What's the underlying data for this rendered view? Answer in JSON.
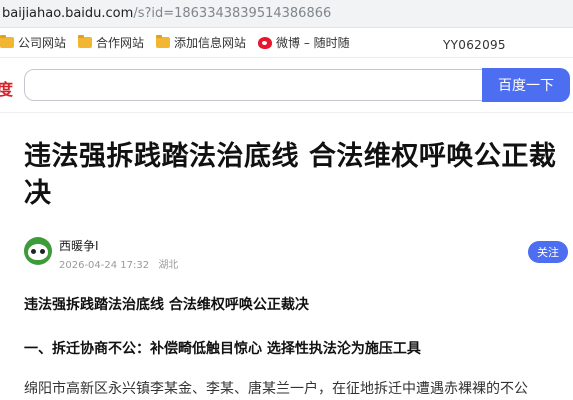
{
  "browser": {
    "url_host": "baijiahao.baidu.com",
    "url_path": "/s?id=1863343839514386866"
  },
  "bookmarks": {
    "items": [
      {
        "label": "公司网站",
        "icon": "folder-icon"
      },
      {
        "label": "合作网站",
        "icon": "folder-icon"
      },
      {
        "label": "添加信息网站",
        "icon": "folder-icon"
      },
      {
        "label": "微博 – 随时随",
        "icon": "weibo-icon"
      }
    ],
    "code": "YY062095"
  },
  "search": {
    "brand_glyph": "度",
    "value": "",
    "button_label": "百度一下"
  },
  "article": {
    "title": "违法强拆践踏法治底线 合法维权呼唤公正裁决",
    "author": "西暖争I",
    "date": "2026-04-24 17:32",
    "location": "湖北",
    "follow_label": "关注",
    "lead_heading": "违法强拆践踏法治底线 合法维权呼唤公正裁决",
    "section_heading": "一、拆迁协商不公：补偿畸低触目惊心 选择性执法沦为施压工具",
    "body_first_line": "绵阳市高新区永兴镇李某金、李某、唐某兰一户，在征地拆迁中遭遇赤裸裸的不公"
  },
  "colors": {
    "accent": "#4e6ef2",
    "folder": "#f2b632",
    "brand_red": "#d6232a"
  }
}
